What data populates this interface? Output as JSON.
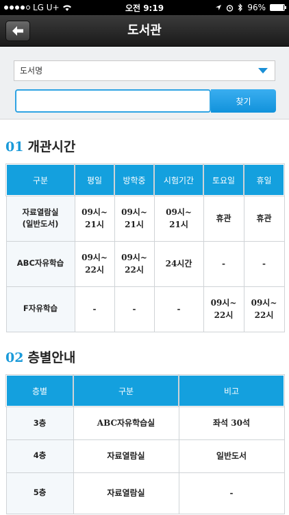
{
  "status_bar": {
    "carrier": "LG U+",
    "time": "오전 9:19",
    "battery": "96%",
    "battery_level": 0.96
  },
  "nav": {
    "title": "도서관",
    "back_icon": "back-arrow-icon"
  },
  "search": {
    "selected_option": "도서명",
    "input_value": "",
    "button_label": "찾기"
  },
  "hours_section": {
    "number": "01",
    "title": "개관시간",
    "headers": [
      "구분",
      "평일",
      "방학중",
      "시험기간",
      "토요일",
      "휴일"
    ],
    "rows": [
      [
        "자료열람실\n(일반도서)",
        "09시~\n21시",
        "09시~\n21시",
        "09시~\n21시",
        "휴관",
        "휴관"
      ],
      [
        "ABC자유학습",
        "09시~\n22시",
        "09시~\n22시",
        "24시간",
        "-",
        "-"
      ],
      [
        "F자유학습",
        "-",
        "-",
        "-",
        "09시~\n22시",
        "09시~\n22시"
      ]
    ]
  },
  "floors_section": {
    "number": "02",
    "title": "층별안내",
    "headers": [
      "층별",
      "구분",
      "비고"
    ],
    "rows": [
      [
        "3층",
        "ABC자유학습실",
        "좌석 30석"
      ],
      [
        "4층",
        "자료열람실",
        "일반도서"
      ],
      [
        "5층",
        "자료열람실",
        "-"
      ]
    ]
  },
  "colors": {
    "accent": "#14a0de",
    "header_bg": "#1a1a1a"
  }
}
